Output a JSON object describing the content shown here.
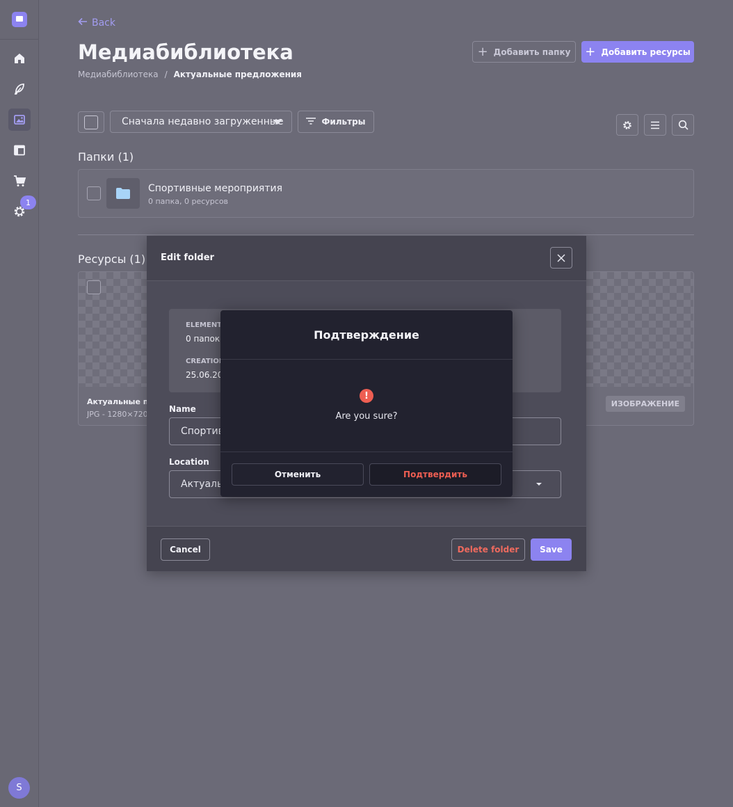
{
  "nav": {
    "back_label": "Back",
    "notification_count": "1",
    "user_initial": "S"
  },
  "page": {
    "title": "Медиабиблиотека",
    "breadcrumb_root": "Медиабиблиотека",
    "breadcrumb_separator": "/",
    "breadcrumb_current": "Актуальные предложения"
  },
  "actions": {
    "add_folder_label": "Добавить папку",
    "add_assets_label": "Добавить ресурсы"
  },
  "toolbar": {
    "sort_selected": "Сначала недавно загруженные",
    "filters_label": "Фильтры"
  },
  "folders": {
    "heading": "Папки (1)",
    "items": [
      {
        "name": "Спортивные мероприятия",
        "meta": "0 папка, 0 ресурсов"
      }
    ]
  },
  "assets": {
    "heading": "Ресурсы (1)",
    "items": [
      {
        "name": "Актуальные пр",
        "meta": "JPG - 1280×720",
        "type": "ИЗОБРАЖЕНИЕ"
      }
    ]
  },
  "edit_folder_modal": {
    "title": "Edit folder",
    "elements_label": "ELEMENT",
    "elements_value": "0 папок, (",
    "creation_label": "CREATION",
    "creation_value": "25.06.202",
    "name_label": "Name",
    "name_value": "Спортивн",
    "location_label": "Location",
    "location_value": "Актуальн",
    "cancel_label": "Cancel",
    "delete_label": "Delete folder",
    "save_label": "Save"
  },
  "confirm_dialog": {
    "title": "Подтверждение",
    "message": "Are you sure?",
    "cancel_label": "Отменить",
    "confirm_label": "Подтвердить"
  },
  "colors": {
    "accent": "#8c83f0",
    "danger": "#ee5e52",
    "background": "#6b6a77",
    "dialog": "#22222f"
  }
}
